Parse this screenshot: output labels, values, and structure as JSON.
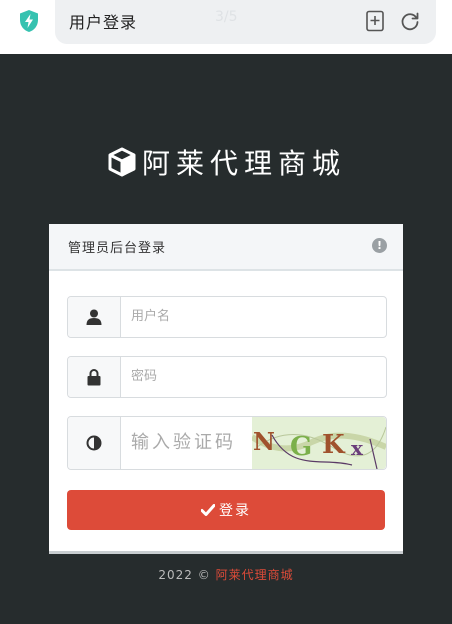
{
  "browser": {
    "tab_title": "用户登录",
    "page_counter": "3/5",
    "icons": {
      "shield": "shield-bolt-icon",
      "bookmark": "bookmark-add-icon",
      "reload": "reload-icon"
    }
  },
  "brand": {
    "name": "阿莱代理商城",
    "icon": "cube-icon"
  },
  "panel": {
    "title": "管理员后台登录",
    "info_icon_char": "!"
  },
  "form": {
    "username": {
      "placeholder": "用户名",
      "value": "",
      "icon": "user-icon"
    },
    "password": {
      "placeholder": "密码",
      "value": "",
      "icon": "lock-icon"
    },
    "captcha": {
      "placeholder": "输入验证码",
      "value": "",
      "icon": "contrast-icon",
      "image_text": "GKx"
    },
    "submit_label": "登录",
    "submit_icon": "check-icon"
  },
  "footer": {
    "copyright": "2022 ©",
    "site_link": "阿莱代理商城"
  },
  "colors": {
    "background": "#262c2d",
    "accent": "#dd4b39",
    "panel": "#ffffff"
  }
}
